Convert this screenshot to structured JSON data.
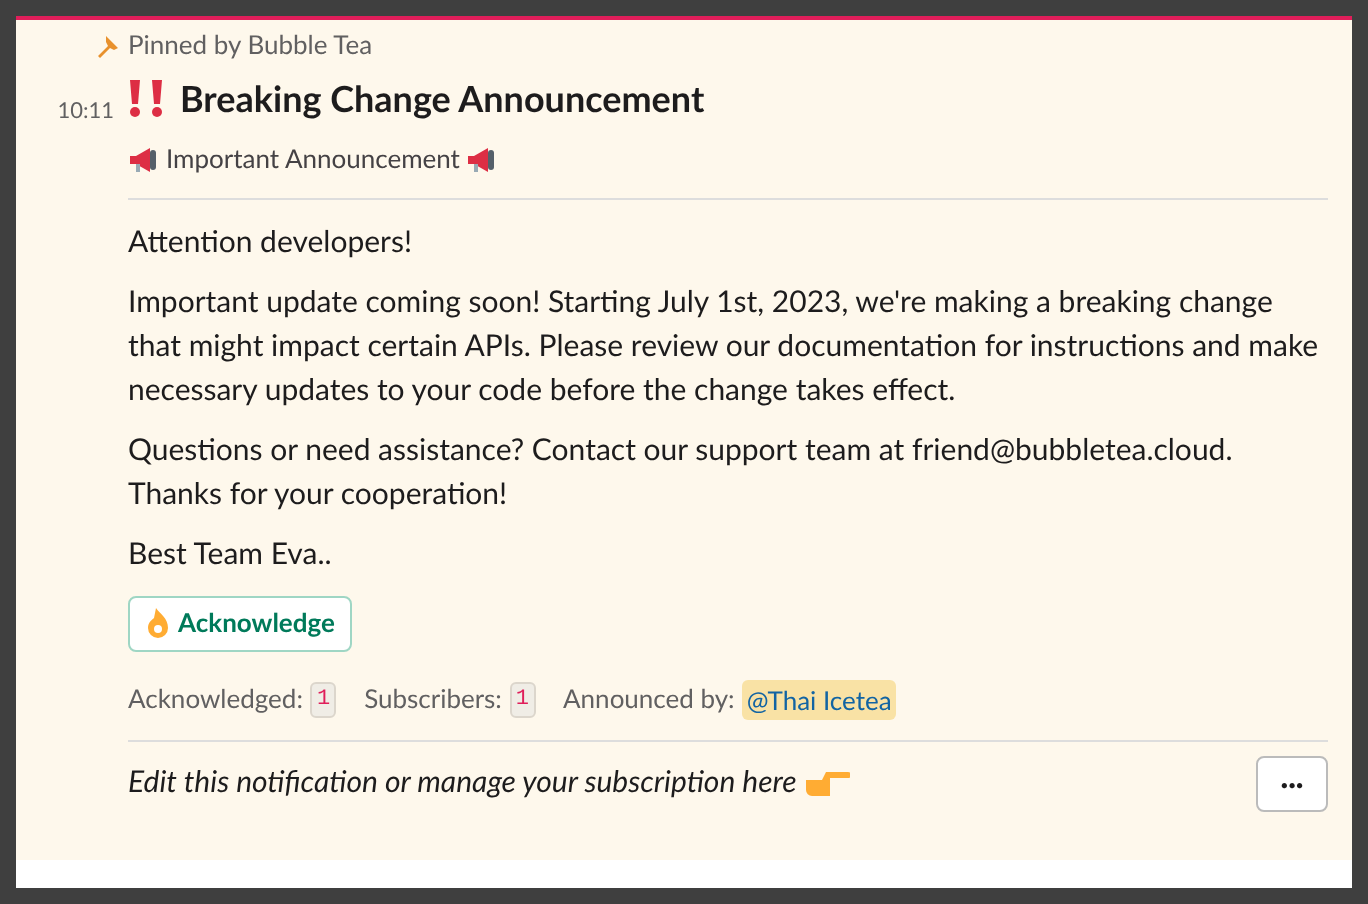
{
  "pinned_by": "Pinned by Bubble Tea",
  "time": "10:11",
  "title": "Breaking Change Announcement",
  "subtitle": "Important Announcement",
  "paragraphs": [
    "Attention developers!",
    "Important update coming soon! Starting July 1st, 2023, we're making a breaking change that might impact certain APIs. Please review our documentation for instructions and make necessary updates to your code before the change takes effect.",
    "Questions or need assistance? Contact our support team at friend@bubbletea.cloud. Thanks for your cooperation!",
    "Best Team Eva.."
  ],
  "acknowledge_button": "Acknowledge",
  "stats": [
    {
      "label": "Acknowledged:",
      "count": "1"
    },
    {
      "label": "Subscribers:",
      "count": "1"
    }
  ],
  "announced_by": {
    "label": "Announced by:",
    "mention": "@Thai Icetea"
  },
  "footer": "Edit this notification or manage your subscription here",
  "more_button": "···"
}
